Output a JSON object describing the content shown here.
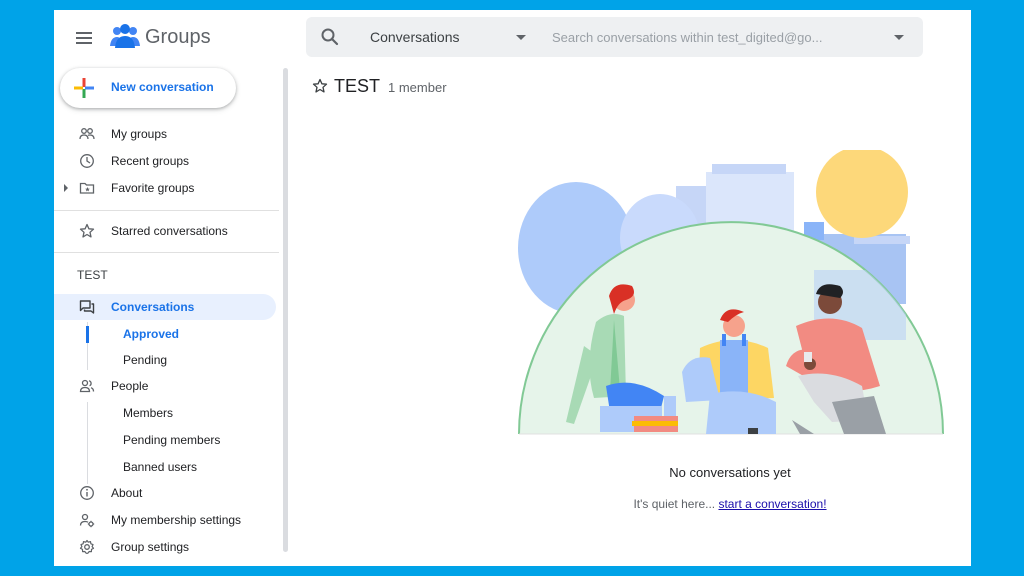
{
  "header": {
    "brand": "Groups",
    "search": {
      "scope": "Conversations",
      "placeholder": "Search conversations within test_digited@go..."
    }
  },
  "sidebar": {
    "new_conversation": "New conversation",
    "items": [
      {
        "label": "My groups",
        "icon": "people-outline-icon"
      },
      {
        "label": "Recent groups",
        "icon": "clock-icon"
      },
      {
        "label": "Favorite groups",
        "icon": "folder-star-icon"
      },
      {
        "label": "Starred conversations",
        "icon": "star-outline-icon"
      }
    ],
    "section_label": "TEST",
    "group_nav": {
      "conversations": "Conversations",
      "approved": "Approved",
      "pending": "Pending",
      "people": "People",
      "members": "Members",
      "pending_members": "Pending members",
      "banned_users": "Banned users",
      "about": "About",
      "membership_settings": "My membership settings",
      "group_settings": "Group settings"
    }
  },
  "main": {
    "group_title": "TEST",
    "member_count": "1 member",
    "empty": {
      "title": "No conversations yet",
      "text": "It's quiet here...",
      "link": "start a conversation!"
    }
  },
  "colors": {
    "accent": "#1a73e8",
    "active_bg": "#e8f0fe",
    "frame": "#00a3e8"
  }
}
